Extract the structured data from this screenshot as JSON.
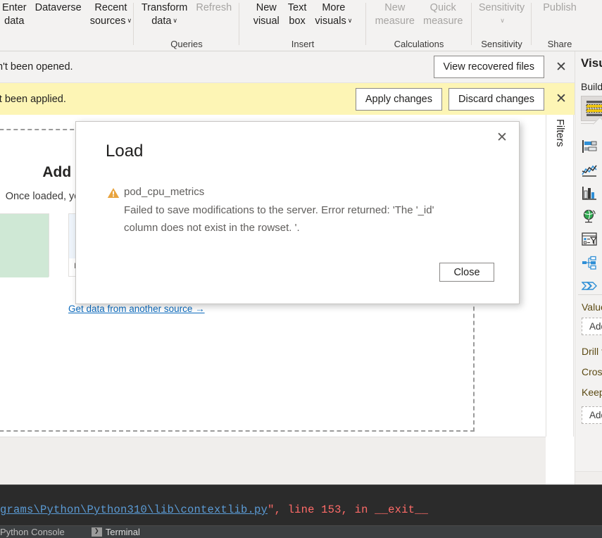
{
  "ribbon": {
    "groups": [
      {
        "id": "data",
        "label": "",
        "buttons": [
          {
            "l1": "Enter",
            "l2": "data",
            "caret": false,
            "disabled": false
          },
          {
            "l1": "Dataverse",
            "l2": "",
            "caret": false,
            "disabled": false
          },
          {
            "l1": "Recent",
            "l2": "sources",
            "caret": true,
            "disabled": false
          }
        ]
      },
      {
        "id": "queries",
        "label": "Queries",
        "buttons": [
          {
            "l1": "Transform",
            "l2": "data",
            "caret": true,
            "disabled": false
          },
          {
            "l1": "Refresh",
            "l2": "",
            "caret": false,
            "disabled": true
          }
        ]
      },
      {
        "id": "insert",
        "label": "Insert",
        "buttons": [
          {
            "l1": "New",
            "l2": "visual",
            "caret": false,
            "disabled": false
          },
          {
            "l1": "Text",
            "l2": "box",
            "caret": false,
            "disabled": false
          },
          {
            "l1": "More",
            "l2": "visuals",
            "caret": true,
            "disabled": false
          }
        ]
      },
      {
        "id": "calculations",
        "label": "Calculations",
        "buttons": [
          {
            "l1": "New",
            "l2": "measure",
            "caret": false,
            "disabled": true
          },
          {
            "l1": "Quick",
            "l2": "measure",
            "caret": false,
            "disabled": true
          }
        ]
      },
      {
        "id": "sensitivity",
        "label": "Sensitivity",
        "buttons": [
          {
            "l1": "Sensitivity",
            "l2": "",
            "caret": true,
            "disabled": true
          }
        ]
      },
      {
        "id": "share",
        "label": "Share",
        "buttons": [
          {
            "l1": "Publish",
            "l2": "",
            "caret": false,
            "disabled": true
          }
        ]
      }
    ]
  },
  "notifications": [
    {
      "id": "recovered",
      "text": "n't been opened.",
      "buttons": [
        "View recovered files"
      ],
      "close_label": "✕"
    },
    {
      "id": "pending-changes",
      "text": "'t been applied.",
      "buttons": [
        "Apply changes",
        "Discard changes"
      ],
      "close_label": "✕"
    }
  ],
  "canvas": {
    "title": "Add data to your report",
    "subtitle": "Once loaded, your data will appear in the Data pane.",
    "cards": [
      {
        "caption": "",
        "icon": "excel-icon"
      },
      {
        "caption": "Import data from SQL Server",
        "icon": "sql-server-icon"
      }
    ],
    "link": "Get data from another source →"
  },
  "filters": {
    "label": "Filters"
  },
  "visualizations": {
    "title": "Visualizations",
    "build_label": "Build visual",
    "selected_visual": "table-visual-icon",
    "icons": [
      "stacked-bar-chart-icon",
      "line-and-area-chart-icon",
      "clustered-column-chart-icon",
      "map-globe-icon",
      "slicer-icon",
      "decomposition-tree-icon",
      "key-influencers-icon"
    ],
    "fields": [
      {
        "label": "Values",
        "dropzone": "Add data fields here"
      }
    ],
    "options": [
      "Drill through",
      "Cross-report",
      "Keep all filters"
    ],
    "bottom_dropzone": "Add drill-through fields here"
  },
  "dialog": {
    "title": "Load",
    "close_icon_label": "✕",
    "warning_icon": "warning-triangle-icon",
    "dataset_name": "pod_cpu_metrics",
    "message_line_1": "Failed to save modifications to the server. Error returned: 'The '_id'",
    "message_line_2": "column does not exist in the rowset. '.",
    "close_button": "Close"
  },
  "terminal": {
    "traceback_path": "grams\\Python\\Python310\\lib\\contextlib.py",
    "traceback_rest": "\", line 153, in __exit__",
    "tabs": [
      {
        "label": "Python Console",
        "icon": "",
        "active": false
      },
      {
        "label": "Terminal",
        "icon": "❯",
        "active": true
      }
    ]
  },
  "colors": {
    "warning": "#e8a33d",
    "notif_yellow": "#fdf5b5",
    "link": "#0d6bbd",
    "terminal_bg": "#2b2b2b",
    "terminal_error": "#ff6b68",
    "terminal_path": "#5b9bd5"
  }
}
